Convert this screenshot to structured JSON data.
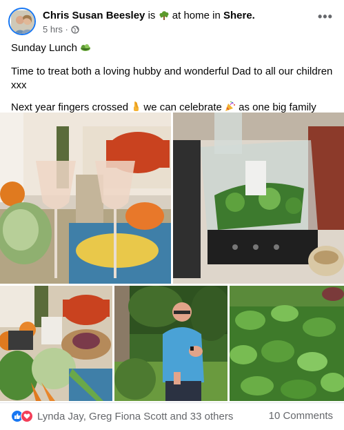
{
  "post": {
    "author": "Chris Susan Beesley",
    "status_prefix": "is",
    "activity_icon": "tree-icon",
    "status_middle": "at home in",
    "location": "Shere.",
    "time": "5 hrs",
    "separator": "·",
    "privacy_icon": "globe-icon",
    "more_label": "•••",
    "body": {
      "line1": "Sunday Lunch",
      "line1_emoji": "salad-icon",
      "line2": "Time to treat both a loving hubby and wonderful Dad to all our children xxx",
      "line3_a": "Next year fingers crossed",
      "line3_emoji1": "fingers-crossed-icon",
      "line3_b": "we can celebrate",
      "line3_emoji2": "party-popper-icon",
      "line3_c": "as one big family"
    },
    "photos": [
      {
        "id": "champagne-photo",
        "subject": "champagne glasses"
      },
      {
        "id": "food-processor-photo",
        "subject": "food processor with mint"
      },
      {
        "id": "kitchen-counter-photo",
        "subject": "vegetables"
      },
      {
        "id": "man-in-garden-photo",
        "subject": "man in garden"
      },
      {
        "id": "mint-plants-photo",
        "subject": "mint plants"
      }
    ]
  },
  "footer": {
    "reaction_icons": [
      "like-icon",
      "love-icon"
    ],
    "reactors": "Lynda Jay, Greg Fiona Scott and 33 others",
    "comments": "10 Comments"
  },
  "colors": {
    "accent": "#1877f2",
    "love": "#f33e58",
    "secondary_text": "#65676b",
    "primary_text": "#050505"
  }
}
